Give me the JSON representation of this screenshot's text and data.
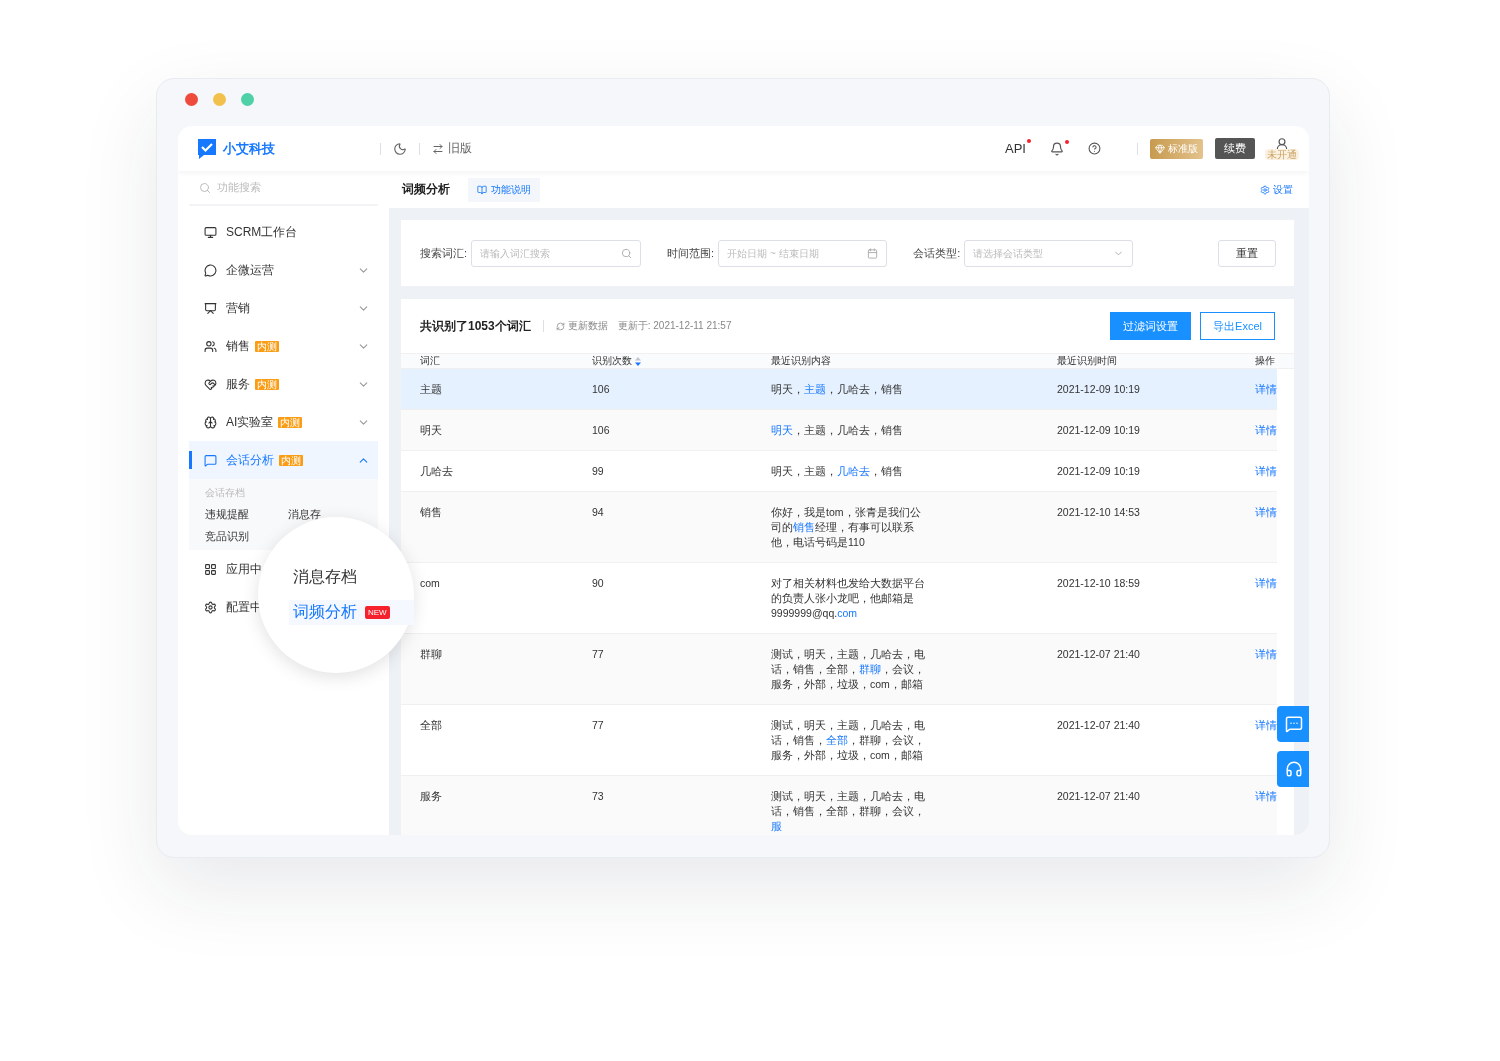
{
  "header": {
    "brand": "小艾科技",
    "old_version": "旧版",
    "api": {
      "label": "API",
      "dot": true
    },
    "bell_dot": true,
    "plan": "标准版",
    "renew": "续费",
    "avatar_label": "未开通"
  },
  "sidebar": {
    "search_placeholder": "功能搜索",
    "items": [
      {
        "label": "SCRM工作台",
        "selected": false
      },
      {
        "label": "企微运营",
        "expanded": false,
        "selected": false
      },
      {
        "label": "营销",
        "expanded": false,
        "selected": false
      },
      {
        "label": "销售",
        "badge": "内测",
        "expanded": false,
        "selected": false
      },
      {
        "label": "服务",
        "badge": "内测",
        "expanded": false,
        "selected": false
      },
      {
        "label": "AI实验室",
        "badge": "内测",
        "expanded": false,
        "selected": false
      },
      {
        "label": "会话分析",
        "badge": "内测",
        "expanded": true,
        "selected": true,
        "group": "会话存档",
        "children": [
          {
            "label": "违规提醒"
          },
          {
            "label": "消息存"
          },
          {
            "label": "竞品识别"
          }
        ]
      },
      {
        "label": "应用中",
        "selected": false
      },
      {
        "label": "配置中",
        "selected": false
      }
    ]
  },
  "magnifier": {
    "items": [
      {
        "label": "消息存档",
        "selected": false
      },
      {
        "label": "词频分析",
        "selected": true,
        "tag": "NEW"
      }
    ]
  },
  "page_tabs": {
    "title": "词频分析",
    "help": "功能说明",
    "settings": "设置"
  },
  "filters": [
    {
      "label": "搜索词汇:",
      "placeholder": "请输入词汇搜索",
      "kind": "search"
    },
    {
      "label": "时间范围:",
      "placeholder": "开始日期 ~ 结束日期",
      "kind": "date"
    },
    {
      "label": "会话类型:",
      "placeholder": "请选择会话类型",
      "kind": "select"
    }
  ],
  "reset": "重置",
  "table": {
    "summary": "共识别了1053个词汇",
    "refresh": "更新数据",
    "updated": "更新于: 2021-12-11 21:57",
    "filter_button": "过滤词设置",
    "export_button": "导出Excel",
    "columns": [
      "词汇",
      "识别次数",
      "最近识别内容",
      "最近识别时间",
      "操作"
    ],
    "rows": [
      {
        "word": "主题",
        "count": "106",
        "content": {
          "before": "明天，",
          "match": "主题",
          "after": "，几哈去，销售"
        },
        "time": "2021-12-09 10:19",
        "action": "详情",
        "selected": true
      },
      {
        "word": "明天",
        "count": "106",
        "content": {
          "match": "明天",
          "after": "，主题，几哈去，销售"
        },
        "time": "2021-12-09 10:19",
        "action": "详情",
        "selected": false
      },
      {
        "word": "几哈去",
        "count": "99",
        "content": {
          "before": "明天，主题，",
          "match": "几哈去",
          "after": "，销售"
        },
        "time": "2021-12-09 10:19",
        "action": "详情",
        "selected": false
      },
      {
        "word": "销售",
        "count": "94",
        "content": {
          "before": "你好，我是tom，张青是我们公司的",
          "match": "销售",
          "after": "经理，有事可以联系他，电话号码是110"
        },
        "time": "2021-12-10 14:53",
        "action": "详情",
        "selected": false
      },
      {
        "word": "com",
        "count": "90",
        "content": {
          "before": "对了相关材料也发给大数据平台的负责人张小龙吧，他邮箱是9999999@qq.",
          "match": "com"
        },
        "time": "2021-12-10 18:59",
        "action": "详情",
        "selected": false
      },
      {
        "word": "群聊",
        "count": "77",
        "content": {
          "before": "测试，明天，主题，几哈去，电话，销售，全部，",
          "match": "群聊",
          "after": "，会议，服务，外部，垃圾，com，邮箱"
        },
        "time": "2021-12-07 21:40",
        "action": "详情",
        "selected": false
      },
      {
        "word": "全部",
        "count": "77",
        "content": {
          "before": "测试，明天，主题，几哈去，电话，销售，",
          "match": "全部",
          "after": "，群聊，会议，服务，外部，垃圾，com，邮箱"
        },
        "time": "2021-12-07 21:40",
        "action": "详情",
        "selected": false
      },
      {
        "word": "服务",
        "count": "73",
        "content": {
          "before": "测试，明天，主题，几哈去，电话，销售，全部，群聊，会议，",
          "match": "服"
        },
        "time": "2021-12-07 21:40",
        "action": "详情",
        "selected": false
      }
    ]
  }
}
